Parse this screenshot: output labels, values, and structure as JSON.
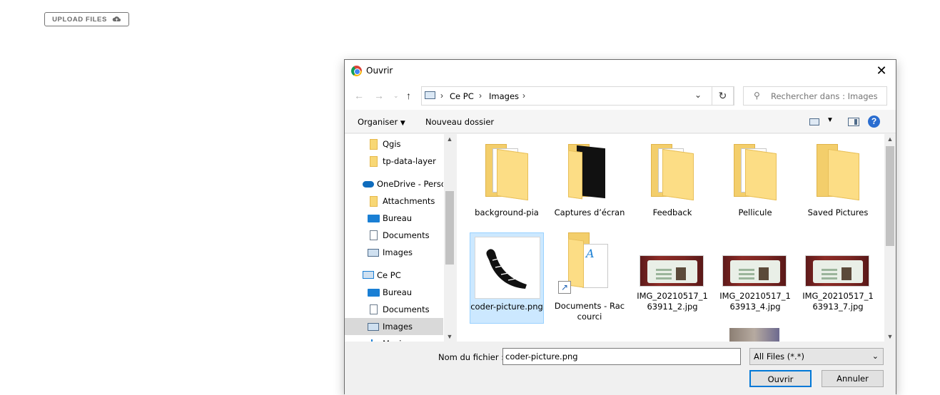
{
  "page": {
    "upload_label": "UPLOAD FILES",
    "upload_icon": "cloud-upload-icon"
  },
  "dialog": {
    "title": "Ouvrir",
    "address": {
      "crumbs": [
        "Ce PC",
        "Images"
      ]
    },
    "search": {
      "placeholder": "Rechercher dans : Images"
    },
    "toolbar": {
      "organise": "Organiser",
      "new_folder": "Nouveau dossier",
      "help": "?"
    },
    "nav": {
      "items": [
        {
          "label": "Qgis",
          "icon": "folder-icon"
        },
        {
          "label": "tp-data-layer",
          "icon": "folder-icon"
        },
        {
          "label": "OneDrive - Persor",
          "icon": "onedrive-icon"
        },
        {
          "label": "Attachments",
          "icon": "folder-icon"
        },
        {
          "label": "Bureau",
          "icon": "desktop-icon"
        },
        {
          "label": "Documents",
          "icon": "document-icon"
        },
        {
          "label": "Images",
          "icon": "pictures-icon"
        },
        {
          "label": "Ce PC",
          "icon": "computer-icon"
        },
        {
          "label": "Bureau",
          "icon": "desktop-icon"
        },
        {
          "label": "Documents",
          "icon": "document-icon"
        },
        {
          "label": "Images",
          "icon": "pictures-icon",
          "selected": true
        },
        {
          "label": "Musique",
          "icon": "music-icon"
        }
      ]
    },
    "files": [
      {
        "name": "background-pia",
        "type": "folder"
      },
      {
        "name": "Captures d’écran",
        "type": "folder"
      },
      {
        "name": "Feedback",
        "type": "folder"
      },
      {
        "name": "Pellicule",
        "type": "folder"
      },
      {
        "name": "Saved Pictures",
        "type": "folder"
      },
      {
        "name": "coder-picture.png",
        "type": "image",
        "selected": true
      },
      {
        "name": "Documents - Raccourci",
        "type": "shortcut"
      },
      {
        "name": "IMG_20210517_163911_2.jpg",
        "type": "photo"
      },
      {
        "name": "IMG_20210517_163913_4.jpg",
        "type": "photo"
      },
      {
        "name": "IMG_20210517_163913_7.jpg",
        "type": "photo"
      }
    ],
    "filename": {
      "label": "Nom du fichier :",
      "value": "coder-picture.png"
    },
    "filetype": {
      "value": "All Files (*.*)"
    },
    "buttons": {
      "open": "Ouvrir",
      "cancel": "Annuler"
    }
  }
}
